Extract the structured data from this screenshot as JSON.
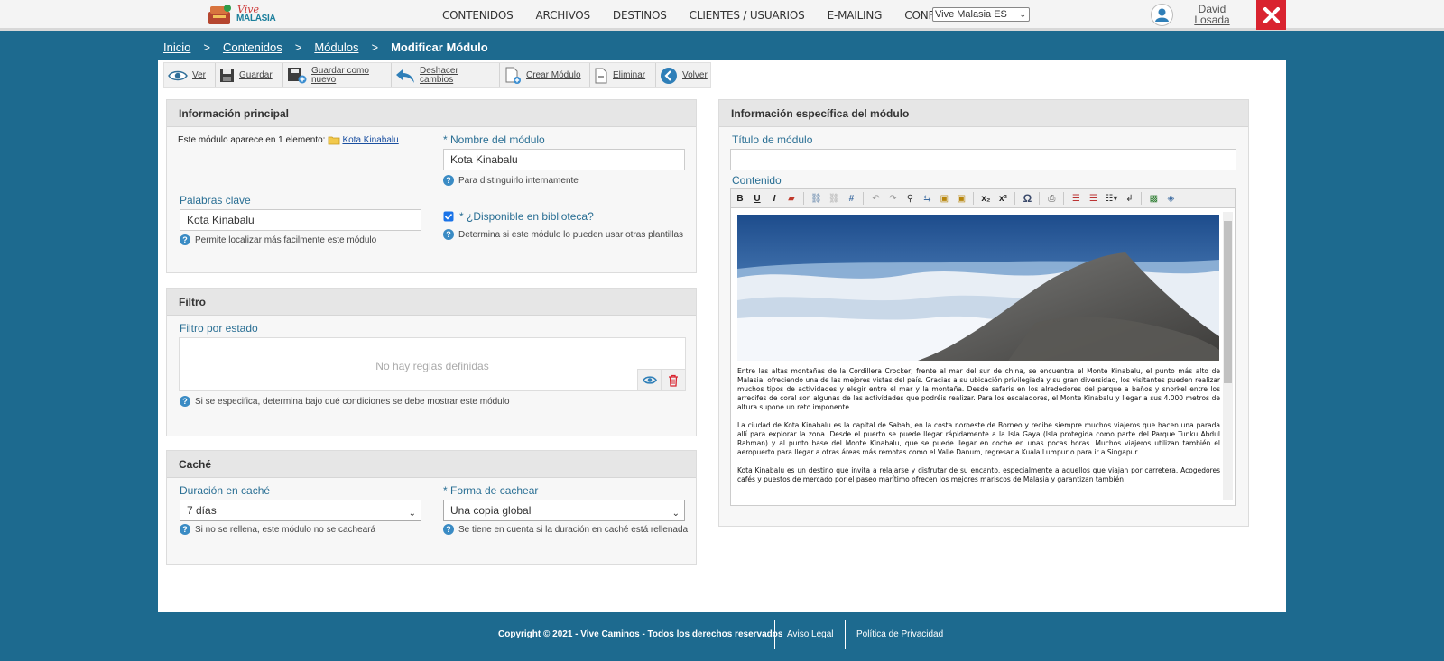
{
  "header": {
    "logo_line1": "Vive",
    "logo_line2": "MALASIA",
    "nav": [
      "CONTENIDOS",
      "ARCHIVOS",
      "DESTINOS",
      "CLIENTES / USUARIOS",
      "E-MAILING",
      "CONFIGURACIÓN"
    ],
    "site_selector": "Vive Malasia ES",
    "user_first": "David",
    "user_last": "Losada"
  },
  "breadcrumb": {
    "items": [
      "Inicio",
      "Contenidos",
      "Módulos"
    ],
    "separator": ">",
    "current": "Modificar Módulo"
  },
  "toolbar": {
    "ver": "Ver",
    "guardar": "Guardar",
    "guardar_nuevo_1": "Guardar como",
    "guardar_nuevo_2": "nuevo",
    "deshacer_1": "Deshacer",
    "deshacer_2": "cambios",
    "crear": "Crear Módulo",
    "eliminar": "Eliminar",
    "volver": "Volver"
  },
  "principal": {
    "title": "Información principal",
    "appears_text": "Este módulo aparece en 1 elemento:",
    "appears_link": "Kota Kinabalu",
    "name_label": "* Nombre del módulo",
    "name_value": "Kota Kinabalu",
    "name_help": "Para distinguirlo internamente",
    "keywords_label": "Palabras clave",
    "keywords_value": "Kota Kinabalu",
    "keywords_help": "Permite localizar más facilmente este módulo",
    "available_label": "* ¿Disponible en biblioteca?",
    "available_checked": true,
    "available_help": "Determina si este módulo lo pueden usar otras plantillas"
  },
  "filtro": {
    "title": "Filtro",
    "label": "Filtro por estado",
    "empty": "No hay reglas definidas",
    "help": "Si se especifica, determina bajo qué condiciones se debe mostrar este módulo"
  },
  "cache": {
    "title": "Caché",
    "duration_label": "Duración en caché",
    "duration_value": "7 días",
    "duration_help": "Si no se rellena, este módulo no se cacheará",
    "mode_label": "* Forma de cachear",
    "mode_value": "Una copia global",
    "mode_help": "Se tiene en cuenta si la duración en caché está rellenada"
  },
  "especifica": {
    "title": "Información específica del módulo",
    "module_title_label": "Título de módulo",
    "module_title_value": "",
    "content_label": "Contenido",
    "paragraphs": [
      "Entre las altas montañas de la Cordillera Crocker, frente al mar del sur de china, se encuentra el Monte Kinabalu, el punto más alto de Malasia, ofreciendo una de las mejores vistas del país. Gracias a su ubicación privilegiada y su gran diversidad, los visitantes pueden realizar muchos tipos de actividades y elegir entre el mar y la montaña. Desde safaris en los alrededores del parque a baños y snorkel entre los arrecifes de coral son algunas de las actividades que podréis realizar. Para los escaladores, el Monte Kinabalu y llegar a sus 4.000 metros de altura supone un reto imponente.",
      "La ciudad de Kota Kinabalu es la capital de Sabah, en la costa noroeste de Borneo y recibe siempre muchos viajeros que hacen una parada allí para explorar la zona. Desde el puerto se puede llegar rápidamente a la Isla Gaya (Isla protegida como parte del Parque Tunku Abdul Rahman) y al punto base del Monte Kinabalu, que se puede llegar en coche en unas pocas horas. Muchos viajeros utilizan también el aeropuerto para llegar a otras áreas más remotas como el Valle Danum, regresar a Kuala Lumpur o para ir a Singapur.",
      "Kota Kinabalu es un destino que invita a relajarse y disfrutar de su encanto, especialmente a aquellos que viajan por carretera. Acogedores cafés y puestos de mercado por el paseo marítimo ofrecen los mejores mariscos de Malasia y garantizan también"
    ]
  },
  "footer": {
    "copyright": "Copyright © 2021 - Vive Caminos - Todos los derechos reservados",
    "legal": "Aviso Legal",
    "privacy": "Política de Privacidad"
  },
  "colors": {
    "brand": "#1d6a8f",
    "accent": "#2a6f94",
    "danger": "#d9232f"
  }
}
